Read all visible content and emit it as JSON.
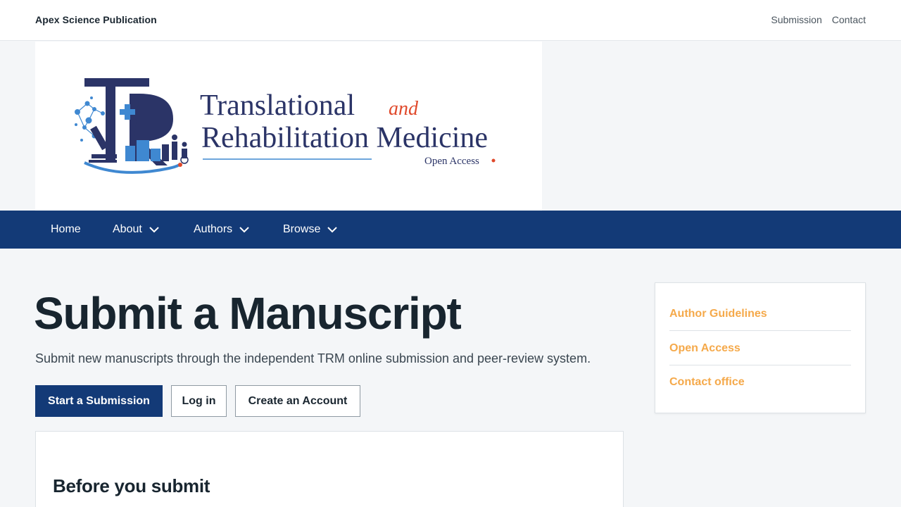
{
  "header": {
    "site_name": "Apex Science Publication",
    "links": [
      "Submission",
      "Contact"
    ]
  },
  "banner": {
    "title_line1": "Translational",
    "title_and": "and",
    "title_line2": "Rehabilitation Medicine",
    "subtitle": "Open Access",
    "monogram": "TR"
  },
  "nav": {
    "items": [
      {
        "label": "Home",
        "dropdown": false
      },
      {
        "label": "About",
        "dropdown": true
      },
      {
        "label": "Authors",
        "dropdown": true
      },
      {
        "label": "Browse",
        "dropdown": true
      }
    ]
  },
  "main": {
    "title": "Submit a Manuscript",
    "intro": "Submit new manuscripts through the independent TRM online submission and peer-review system.",
    "buttons": {
      "start": "Start a Submission",
      "login": "Log in",
      "create": "Create an Account"
    },
    "card_title": "Before you submit"
  },
  "sidebar": {
    "links": [
      "Author Guidelines",
      "Open Access",
      "Contact office"
    ]
  },
  "colors": {
    "nav_bg": "#133a77",
    "accent_orange": "#f5a94a",
    "logo_navy": "#2b3467",
    "logo_red": "#e0492b",
    "logo_blue": "#3f88d1"
  }
}
